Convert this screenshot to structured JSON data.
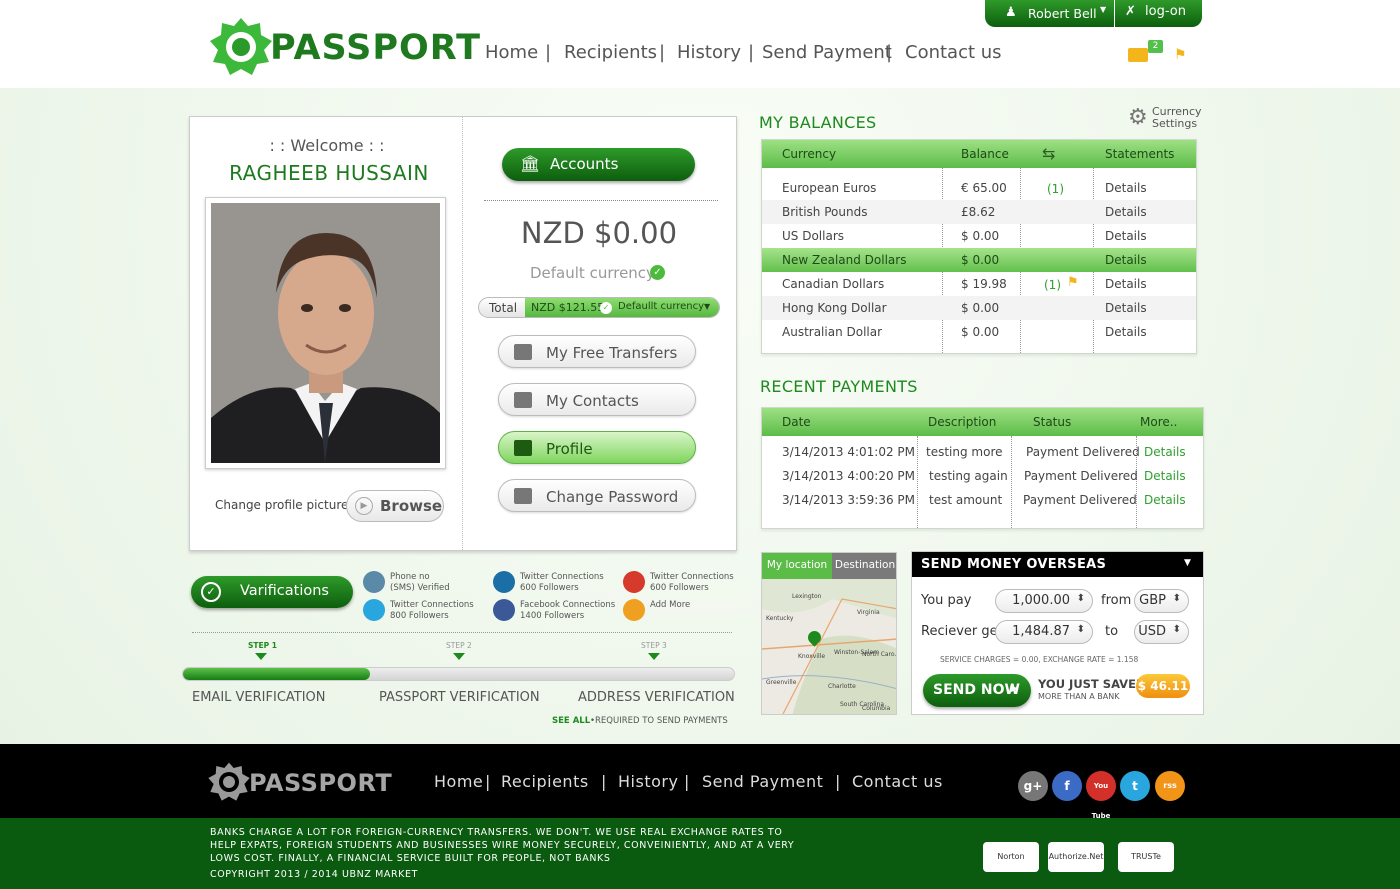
{
  "header": {
    "logo": "PASSPORT",
    "user": "Robert Bell",
    "logon": "log-on",
    "mail_count": "2",
    "nav": [
      "Home",
      "Recipients",
      "History",
      "Send Payment",
      "Contact us"
    ],
    "sep": "|"
  },
  "profile": {
    "welcome": ": : Welcome : :",
    "name": "RAGHEEB HUSSAIN",
    "change_picture": "Change profile picture",
    "browse": "Browse"
  },
  "account": {
    "accounts_label": "Accounts",
    "balance": "NZD $0.00",
    "default_label": "Default currency",
    "total_label": "Total",
    "total_value": "NZD $121.55",
    "default_currency": "Defaullt currency",
    "menu": [
      "My Free Transfers",
      "My Contacts",
      "Profile",
      "Change Password"
    ]
  },
  "verifications": {
    "label": "Varifications",
    "social": [
      {
        "line1": "Phone no",
        "line2": "(SMS) Verified",
        "icon": "phone-icon",
        "color": "#5a8aa8"
      },
      {
        "line1": "Twitter Connections",
        "line2": "600 Followers",
        "icon": "linkedin-icon",
        "color": "#1b6fa6"
      },
      {
        "line1": "Twitter Connections",
        "line2": "600 Followers",
        "icon": "google-plus-icon",
        "color": "#d63a2a"
      },
      {
        "line1": "Twitter Connections",
        "line2": "800 Followers",
        "icon": "twitter-icon",
        "color": "#2aa6df"
      },
      {
        "line1": "Facebook Connections",
        "line2": "1400 Followers",
        "icon": "facebook-icon",
        "color": "#3b5998"
      },
      {
        "line1": "Add More",
        "line2": "",
        "icon": "add-icon",
        "color": "#f0a020"
      }
    ],
    "steps": [
      "STEP 1",
      "STEP 2",
      "STEP 3"
    ],
    "stage_labels": [
      "EMAIL VERIFICATION",
      "PASSPORT VERIFICATION",
      "ADDRESS VERIFICATION"
    ],
    "progress": 0.34,
    "see_all": "SEE ALL",
    "required": "•REQUIRED TO SEND PAYMENTS"
  },
  "balances": {
    "title": "MY BALANCES",
    "settings_line1": "Currency",
    "settings_line2": "Settings",
    "headers": {
      "currency": "Currency",
      "balance": "Balance",
      "statements": "Statements"
    },
    "rows": [
      {
        "currency": "European Euros",
        "balance": "€ 65.00",
        "pending": "(1)",
        "statement": "Details"
      },
      {
        "currency": "British Pounds",
        "balance": "£8.62",
        "pending": "",
        "statement": "Details"
      },
      {
        "currency": "US Dollars",
        "balance": "$ 0.00",
        "pending": "",
        "statement": "Details"
      },
      {
        "currency": "New Zealand Dollars",
        "balance": "$ 0.00",
        "pending": "",
        "statement": "Details"
      },
      {
        "currency": "Canadian Dollars",
        "balance": "$ 19.98",
        "pending": "(1)",
        "statement": "Details"
      },
      {
        "currency": "Hong Kong Dollar",
        "balance": "$ 0.00",
        "pending": "",
        "statement": "Details"
      },
      {
        "currency": "Australian Dollar",
        "balance": "$ 0.00",
        "pending": "",
        "statement": "Details"
      }
    ]
  },
  "payments": {
    "title": "RECENT PAYMENTS",
    "headers": {
      "date": "Date",
      "description": "Description",
      "status": "Status",
      "more": "More.."
    },
    "rows": [
      {
        "date": "3/14/2013 4:01:02 PM",
        "description": "testing more",
        "status": "Payment Delivered",
        "link": "Details"
      },
      {
        "date": "3/14/2013 4:00:20 PM",
        "description": "testing again",
        "status": "Payment Delivered",
        "link": "Details"
      },
      {
        "date": "3/14/2013 3:59:36 PM",
        "description": "test amount",
        "status": "Payment Delivered",
        "link": "Details"
      }
    ]
  },
  "map": {
    "tab_active": "My location",
    "tab_other": "Destination",
    "labels": [
      "Lexington",
      "Kentucky",
      "Virginia",
      "Knoxville",
      "North Caro...",
      "Greenville",
      "Winston-Salem",
      "Charlotte",
      "South Carolina",
      "Columbia"
    ]
  },
  "send": {
    "title": "SEND MONEY OVERSEAS",
    "you_pay": "You pay",
    "pay_amount": "1,000.00",
    "from": "from",
    "from_cur": "GBP",
    "receiver_gets": "Reciever gets",
    "get_amount": "1,484.87",
    "to": "to",
    "to_cur": "USD",
    "charges": "SERVICE CHARGES = 0.00, EXCHANGE RATE = 1.158",
    "button": "SEND NOW",
    "saved_line1": "YOU JUST SAVED",
    "saved_line2": "MORE THAN A BANK",
    "saved_amount": "$ 46.11"
  },
  "footer": {
    "logo": "PASSPORT",
    "nav": [
      "Home",
      "Recipients",
      "History",
      "Send Payment",
      "Contact us"
    ],
    "social": [
      "g+",
      "f",
      "You Tube",
      "t",
      "rss"
    ],
    "legal": "BANKS CHARGE A LOT FOR FOREIGN-CURRENCY TRANSFERS. WE DON'T. WE USE REAL EXCHANGE RATES TO HELP EXPATS, FOREIGN STUDENTS AND BUSINESSES WIRE MONEY SECURELY, CONVEINIENTLY, AND AT A VERY LOWS COST. FINALLY, A FINANCIAL SERVICE BUILT FOR PEOPLE, NOT BANKS",
    "copyright": "COPYRIGHT 2013 / 2014 UBNZ MARKET",
    "badges": [
      "Norton",
      "Authorize.Net",
      "TRUSTe"
    ]
  },
  "colors": {
    "brand_green": "#1e8a1e",
    "dark_green": "#0a5a10",
    "accent_orange": "#f0a020"
  }
}
